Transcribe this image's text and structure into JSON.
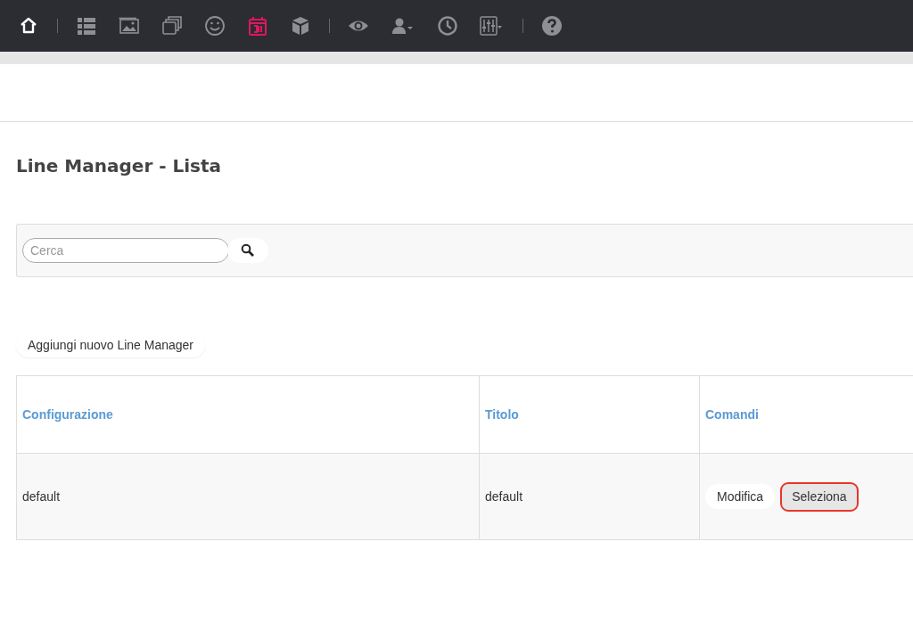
{
  "toolbar": {
    "groups": [
      [
        {
          "kind": "home",
          "selected": false
        }
      ],
      [
        {
          "kind": "list",
          "selected": false
        },
        {
          "kind": "image",
          "selected": false
        },
        {
          "kind": "windows",
          "selected": false
        },
        {
          "kind": "smile",
          "selected": false
        },
        {
          "kind": "calendar",
          "selected": true
        },
        {
          "kind": "box",
          "selected": false
        }
      ],
      [
        {
          "kind": "eye",
          "selected": false
        },
        {
          "kind": "users",
          "selected": false
        },
        {
          "kind": "clock",
          "selected": false
        },
        {
          "kind": "sliders",
          "selected": false
        }
      ],
      [
        {
          "kind": "help",
          "selected": false
        }
      ]
    ]
  },
  "page_title": "Line Manager - Lista",
  "search": {
    "placeholder": "Cerca"
  },
  "add_button": "Aggiungi nuovo Line Manager",
  "table": {
    "columns": [
      "Configurazione",
      "Titolo",
      "Comandi"
    ],
    "rows": [
      {
        "cells": [
          "default",
          "default"
        ],
        "commands": [
          {
            "label": "Modifica",
            "highlighted": false
          },
          {
            "label": "Seleziona",
            "highlighted": true
          }
        ]
      }
    ]
  }
}
